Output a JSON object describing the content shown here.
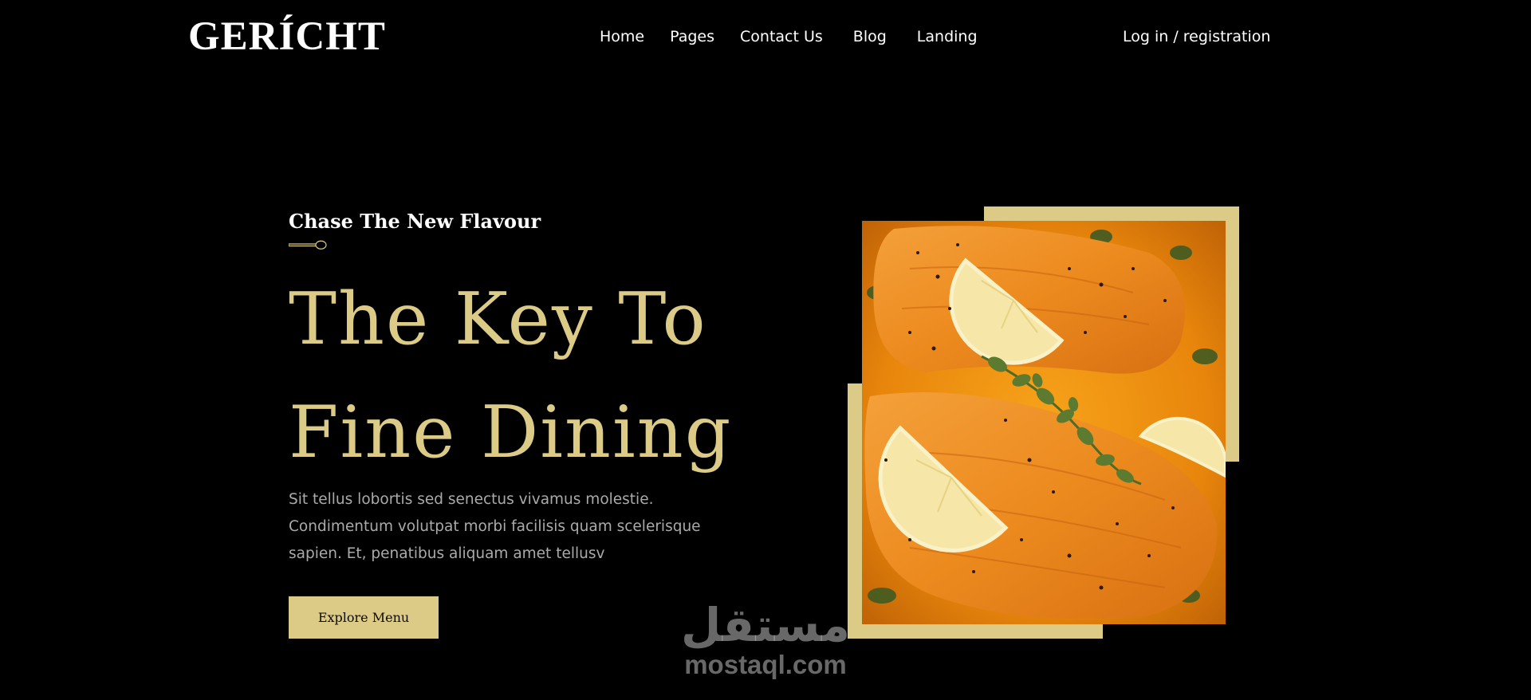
{
  "header": {
    "logo": "GERÍCHT",
    "nav": [
      "Home",
      "Pages",
      "Contact Us",
      "Blog",
      "Landing"
    ],
    "login": "Log in / registration"
  },
  "hero": {
    "subtitle": "Chase The New Flavour",
    "headline_line1": "The Key To",
    "headline_line2": "Fine Dining",
    "description": "Sit tellus lobortis sed senectus vivamus molestie. Condimentum volutpat morbi facilisis quam scelerisque sapien. Et, penatibus aliquam amet tellusv",
    "button_label": "Explore Menu",
    "image_icon": "salmon-dish-photo"
  },
  "watermark": {
    "arabic": "مستقل",
    "latin": "mostaql.com"
  },
  "colors": {
    "background": "#000000",
    "accent": "#dcca87",
    "text": "#ffffff",
    "muted_text": "#aaaaaa"
  }
}
